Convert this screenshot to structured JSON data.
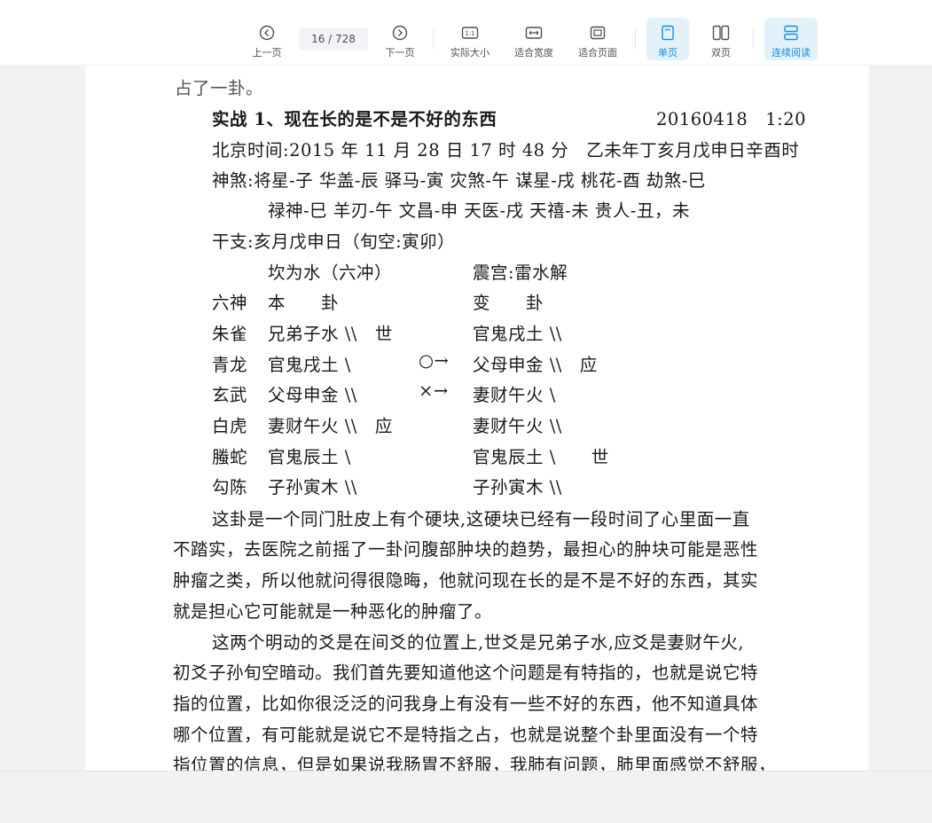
{
  "toolbar": {
    "prev_label": "上一页",
    "page_current": "16",
    "page_total": "728",
    "page_display": "16 / 728",
    "next_label": "下一页",
    "actual_size_label": "实际大小",
    "fit_width_label": "适合宽度",
    "fit_page_label": "适合页面",
    "single_page_label": "单页",
    "double_page_label": "双页",
    "continuous_label": "连续阅读",
    "accent_color": "#1a8ee1"
  },
  "document": {
    "line_top": "占了一卦。",
    "heading": "实战 1、现在长的是不是不好的东西",
    "heading_date": "20160418　1:20",
    "beijing_time": "北京时间:2015 年 11 月 28 日 17 时 48 分　乙未年丁亥月戊申日辛酉时",
    "shensha_1": "神煞:将星-子  华盖-辰  驿马-寅  灾煞-午  谋星-戌  桃花-酉  劫煞-巳",
    "shensha_2": "禄神-巳  羊刃-午  文昌-申  天医-戌  天禧-未  贵人-丑，未",
    "ganzhi": "干支:亥月戊申日（旬空:寅卯）",
    "gua_left_title": "坎为水（六冲）",
    "gua_right_title": "震宫:雷水解",
    "header_liushen": "六神",
    "header_ben": "本　　卦",
    "header_bian": "变　　卦",
    "rows": [
      {
        "shen": "朱雀",
        "ben": "兄弟子水  \\\\　世",
        "mark": "",
        "bian": "官鬼戌土  \\\\"
      },
      {
        "shen": "青龙",
        "ben": "官鬼戌土  \\",
        "mark": "○→",
        "bian": "父母申金  \\\\　应"
      },
      {
        "shen": "玄武",
        "ben": "父母申金  \\\\",
        "mark": "×→",
        "bian": "妻财午火  \\"
      },
      {
        "shen": "白虎",
        "ben": "妻财午火  \\\\　应",
        "mark": "",
        "bian": "妻财午火  \\\\"
      },
      {
        "shen": "螣蛇",
        "ben": "官鬼辰土  \\",
        "mark": "",
        "bian": "官鬼辰土  \\　　世"
      },
      {
        "shen": "勾陈",
        "ben": "子孙寅木  \\\\",
        "mark": "",
        "bian": "子孙寅木  \\\\"
      }
    ],
    "p1_l1": "这卦是一个同门肚皮上有个硬块,这硬块已经有一段时间了心里面一直",
    "p1_l2": "不踏实，去医院之前摇了一卦问腹部肿块的趋势，最担心的肿块可能是恶性",
    "p1_l3": "肿瘤之类，所以他就问得很隐晦，他就问现在长的是不是不好的东西，其实",
    "p1_l4": "就是担心它可能就是一种恶化的肿瘤了。",
    "p2_l1": "这两个明动的爻是在间爻的位置上,世爻是兄弟子水,应爻是妻财午火,",
    "p2_l2": "初爻子孙旬空暗动。我们首先要知道他这个问题是有特指的，也就是说它特",
    "p2_l3": "指的位置，比如你很泛泛的问我身上有没有一些不好的东西，他不知道具体",
    "p2_l4": "哪个位置，有可能就是说它不是特指之占，也就是说整个卦里面没有一个特",
    "p2_l5": "指位置的信息，但是如果说我肠胃不舒服，我肺有问题，肺里面感觉不舒服，"
  }
}
